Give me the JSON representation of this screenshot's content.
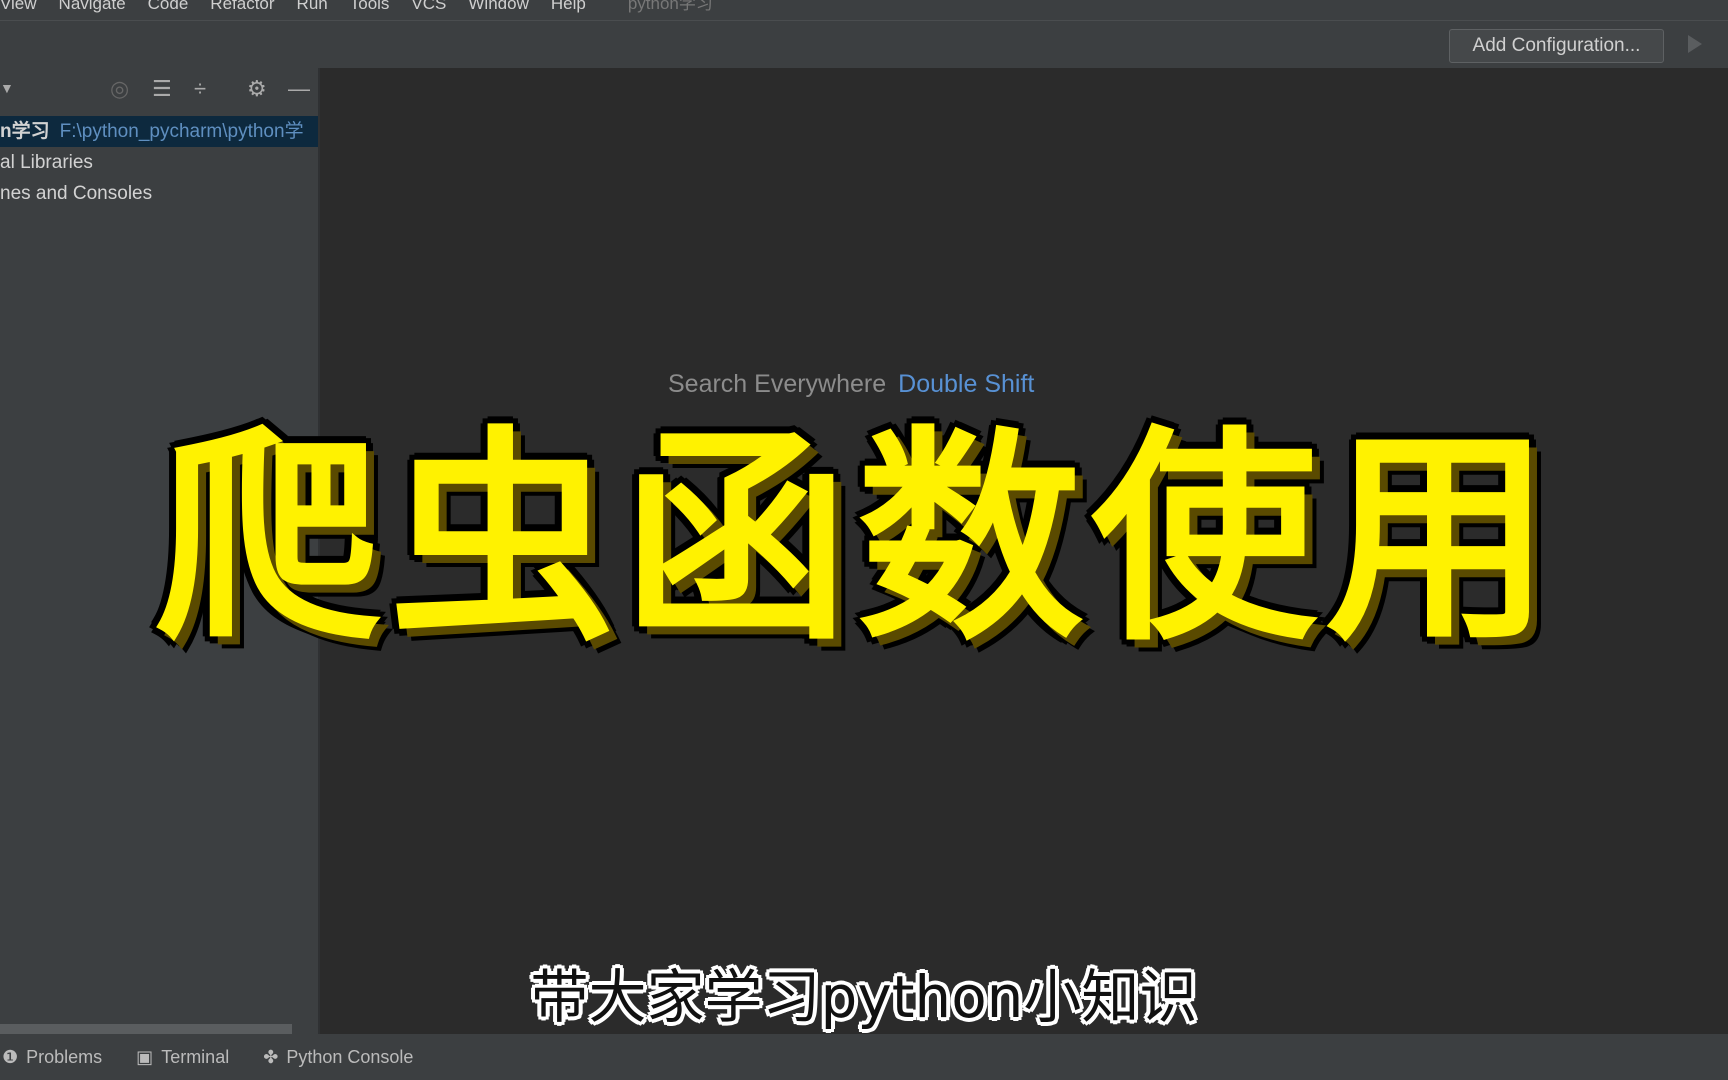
{
  "menu": {
    "items": [
      "View",
      "Navigate",
      "Code",
      "Refactor",
      "Run",
      "Tools",
      "VCS",
      "Window",
      "Help"
    ],
    "project_title": "python学习"
  },
  "toolbar": {
    "add_configuration": "Add Configuration..."
  },
  "sidebar": {
    "project_row": {
      "name": "n学习",
      "path": "F:\\python_pycharm\\python学"
    },
    "items": [
      "al Libraries",
      "nes and Consoles"
    ]
  },
  "editor": {
    "hints": [
      {
        "label": "Search Everywhere",
        "key": "Double Shift"
      }
    ]
  },
  "overlay": {
    "title": "爬虫函数使用",
    "subtitle": "带大家学习python小知识"
  },
  "bottom_bar": {
    "tabs": [
      {
        "label": "Problems",
        "icon": "problems-icon"
      },
      {
        "label": "Terminal",
        "icon": "terminal-icon"
      },
      {
        "label": "Python Console",
        "icon": "python-icon"
      }
    ]
  },
  "colors": {
    "title_yellow": "#fff200",
    "shortcut_blue": "#5891d4",
    "selection": "#0d293e"
  }
}
